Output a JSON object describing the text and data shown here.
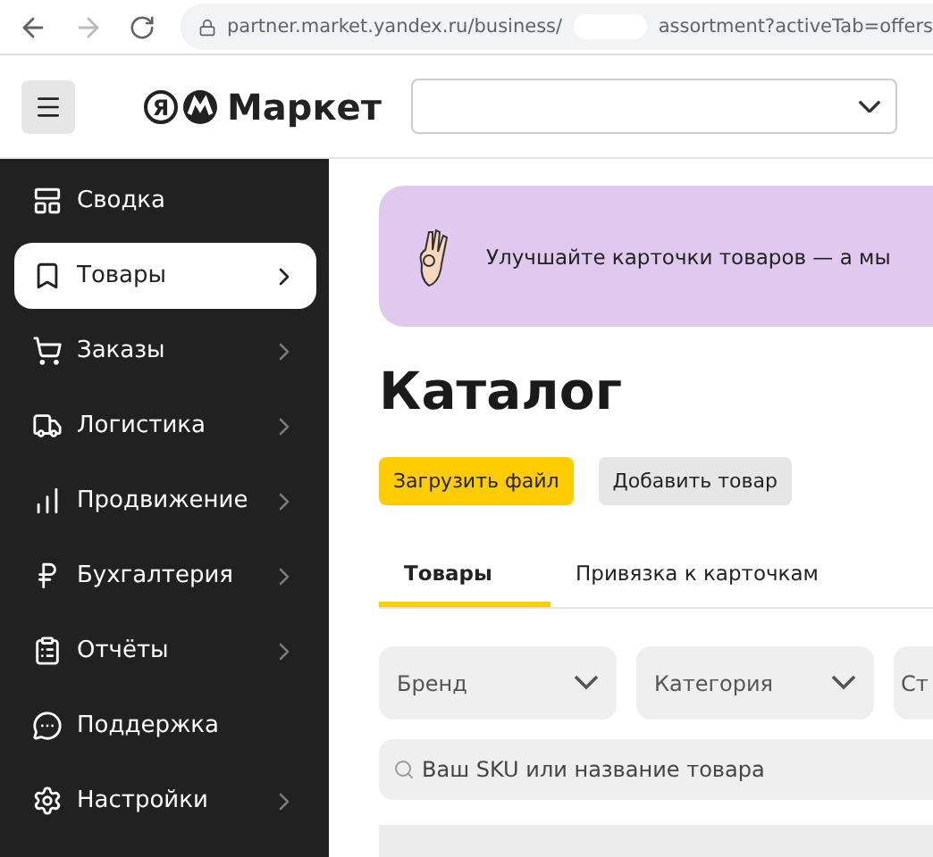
{
  "browser": {
    "url_start": "partner.market.yandex.ru/business/",
    "url_end": "assortment?activeTab=offers"
  },
  "header": {
    "logo_letter": "Я",
    "logo_text": "Маркет"
  },
  "sidebar": {
    "items": [
      {
        "label": "Сводка",
        "kind": "summary",
        "has_children": false,
        "selected": false
      },
      {
        "label": "Товары",
        "kind": "goods",
        "has_children": true,
        "selected": true
      },
      {
        "label": "Заказы",
        "kind": "orders",
        "has_children": true,
        "selected": false
      },
      {
        "label": "Логистика",
        "kind": "logistics",
        "has_children": true,
        "selected": false
      },
      {
        "label": "Продвижение",
        "kind": "promotion",
        "has_children": true,
        "selected": false
      },
      {
        "label": "Бухгалтерия",
        "kind": "accounting",
        "has_children": true,
        "selected": false
      },
      {
        "label": "Отчёты",
        "kind": "reports",
        "has_children": true,
        "selected": false
      },
      {
        "label": "Поддержка",
        "kind": "support",
        "has_children": false,
        "selected": false
      },
      {
        "label": "Настройки",
        "kind": "settings",
        "has_children": true,
        "selected": false
      }
    ]
  },
  "banner": {
    "text": "Улучшайте карточки товаров — а мы"
  },
  "page_title": "Каталог",
  "actions": [
    {
      "label": "Загрузить файл",
      "kind": "primary"
    },
    {
      "label": "Добавить товар",
      "kind": "secondary"
    }
  ],
  "tabs": [
    {
      "label": "Товары",
      "selected": true
    },
    {
      "label": "Привязка к карточкам",
      "selected": false
    }
  ],
  "filters": [
    {
      "label": "Бренд"
    },
    {
      "label": "Категория"
    },
    {
      "label": "Ст"
    }
  ],
  "search": {
    "placeholder": "Ваш SKU или название товара"
  }
}
